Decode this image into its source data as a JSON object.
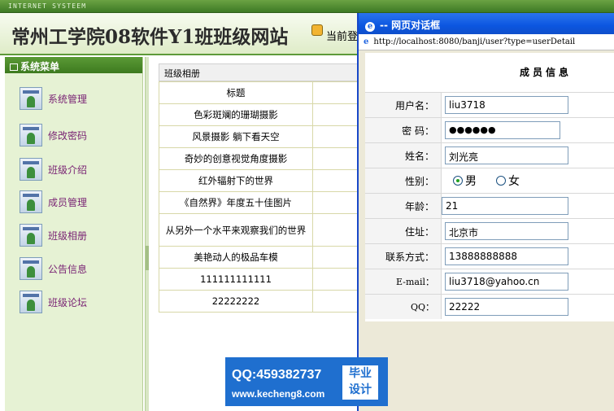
{
  "top_strip": {
    "text": "INTERNET SYSTEEM"
  },
  "header": {
    "site_title": "常州工学院08软件Y1班班级网站",
    "login_text": "当前登"
  },
  "menu": {
    "title": "系统菜单",
    "items": [
      {
        "label": "系统管理",
        "icon": "user-card-icon"
      },
      {
        "label": "修改密码",
        "icon": "user-card-icon"
      },
      {
        "label": "班级介绍",
        "icon": "user-card-icon"
      },
      {
        "label": "成员管理",
        "icon": "user-card-icon"
      },
      {
        "label": "班级相册",
        "icon": "user-card-icon"
      },
      {
        "label": "公告信息",
        "icon": "user-card-icon"
      },
      {
        "label": "班级论坛",
        "icon": "user-card-icon"
      }
    ]
  },
  "gallery": {
    "header": "班级相册",
    "column_title": "标题",
    "rows": [
      "色彩斑斓的珊瑚摄影",
      "风景摄影 躺下看天空",
      "奇妙的创意视觉角度摄影",
      "红外辐射下的世界",
      "《自然界》年度五十佳图片",
      "从另外一个水平来观察我们的世界",
      "美艳动人的极品车模",
      "111111111111",
      "22222222"
    ]
  },
  "dialog": {
    "title": "-- 网页对话框",
    "url": "http://localhost:8080/banji/user?type=userDetail",
    "form_title": "成员信息",
    "fields": {
      "username": {
        "label": "用户名：",
        "value": "liu3718"
      },
      "password": {
        "label": "密 码：",
        "value": "●●●●●●"
      },
      "name": {
        "label": "姓名：",
        "value": "刘光亮"
      },
      "gender": {
        "label": "性别：",
        "male": "男",
        "female": "女",
        "selected": "男"
      },
      "age": {
        "label": "年龄：",
        "value": "21"
      },
      "address": {
        "label": "住址：",
        "value": "北京市"
      },
      "phone": {
        "label": "联系方式：",
        "value": "13888888888"
      },
      "email": {
        "label": "E-mail：",
        "value": "liu3718@yahoo.cn"
      },
      "qq": {
        "label": "QQ：",
        "value": "22222"
      }
    }
  },
  "watermark": {
    "qq": "QQ:459382737",
    "site": "www.kecheng8.com",
    "badge_line1": "毕业",
    "badge_line2": "设计"
  },
  "colors": {
    "menu_bg": "#e6f2d4",
    "title_bar": "#0c56e0",
    "menu_label": "#7a2474",
    "watermark_bg": "#1f6fcf"
  }
}
